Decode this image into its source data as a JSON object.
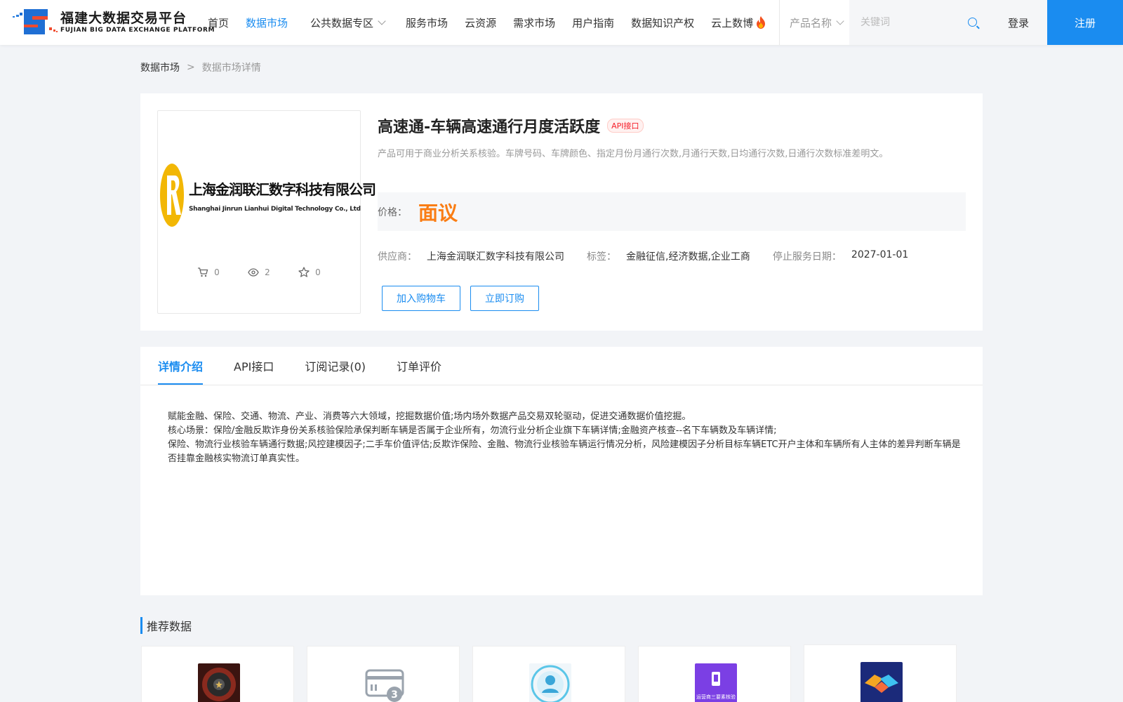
{
  "header": {
    "logo_cn": "福建大数据交易平台",
    "logo_en": "FUJIAN BIG DATA EXCHANGE  PLATFORM",
    "nav": [
      {
        "label": "首页",
        "active": false
      },
      {
        "label": "数据市场",
        "active": true
      },
      {
        "label": "公共数据专区",
        "active": false
      },
      {
        "label": "服务市场",
        "active": false
      },
      {
        "label": "云资源",
        "active": false
      },
      {
        "label": "需求市场",
        "active": false
      },
      {
        "label": "用户指南",
        "active": false
      },
      {
        "label": "数据知识产权",
        "active": false
      },
      {
        "label": "云上数博",
        "active": false
      }
    ],
    "search_type": "产品名称",
    "search_placeholder": "关键词",
    "login": "登录",
    "register": "注册"
  },
  "breadcrumb": {
    "parent": "数据市场",
    "separator": ">",
    "current": "数据市场详情"
  },
  "product": {
    "title": "高速通-车辆高速通行月度活跃度",
    "badge": "API接口",
    "description": "产品可用于商业分析关系核验。车牌号码、车牌颜色、指定月份月通行次数,月通行天数,日均通行次数,日通行次数标准差明文。",
    "price_label": "价格：",
    "price_value": "面议",
    "supplier_label": "供应商：",
    "supplier_value": "上海金润联汇数字科技有限公司",
    "tags_label": "标签：",
    "tags_value": "金融征信,经济数据,企业工商",
    "stop_label": "停止服务日期：",
    "stop_value": "2027-01-01",
    "btn_cart": "加入购物车",
    "btn_order": "立即订购",
    "thumb_logo_cn": "上海金润联汇数字科技有限公司",
    "thumb_logo_en": "Shanghai Jinrun Lianhui Digital Technology Co., Ltd",
    "stats": {
      "cart": "0",
      "views": "2",
      "favorites": "0"
    }
  },
  "tabs": [
    {
      "label": "详情介绍",
      "active": true
    },
    {
      "label": "API接口",
      "active": false
    },
    {
      "label": "订阅记录(0)",
      "active": false
    },
    {
      "label": "订单评价",
      "active": false
    }
  ],
  "content": {
    "line1": "赋能金融、保险、交通、物流、产业、消费等六大领域，挖掘数据价值;场内场外数据产品交易双轮驱动，促进交通数据价值挖掘。",
    "line2": "核心场景：保险/金融反欺诈身份关系核验保险承保判断车辆是否属于企业所有，勿流行业分析企业旗下车辆详情;金融资产核查--名下车辆数及车辆详情;",
    "line3": "保险、物流行业核验车辆通行数据;风控建模因子;二手车价值评估;反欺诈保险、金融、物流行业核验车辆运行情况分析，风险建模因子分析目标车辆ETC开户主体和车辆所有人主体的差异判断车辆是否挂靠金融核实物流订单真实性。"
  },
  "recommend": {
    "title": "推荐数据",
    "items": [
      {
        "icon": "vault-icon",
        "color": "#8a2a1e"
      },
      {
        "icon": "card-icon",
        "color": "#9aa3ad"
      },
      {
        "icon": "user-scan-icon",
        "color": "#5bc6e8"
      },
      {
        "icon": "phone-icon",
        "color": "#7b3fe4",
        "caption": "运营商三要素核验"
      },
      {
        "icon": "handshake-icon",
        "color": "#2b4ac9"
      }
    ]
  },
  "colors": {
    "accent": "#1a8cf0",
    "price": "#fa7d14",
    "badge": "#f5222d"
  }
}
